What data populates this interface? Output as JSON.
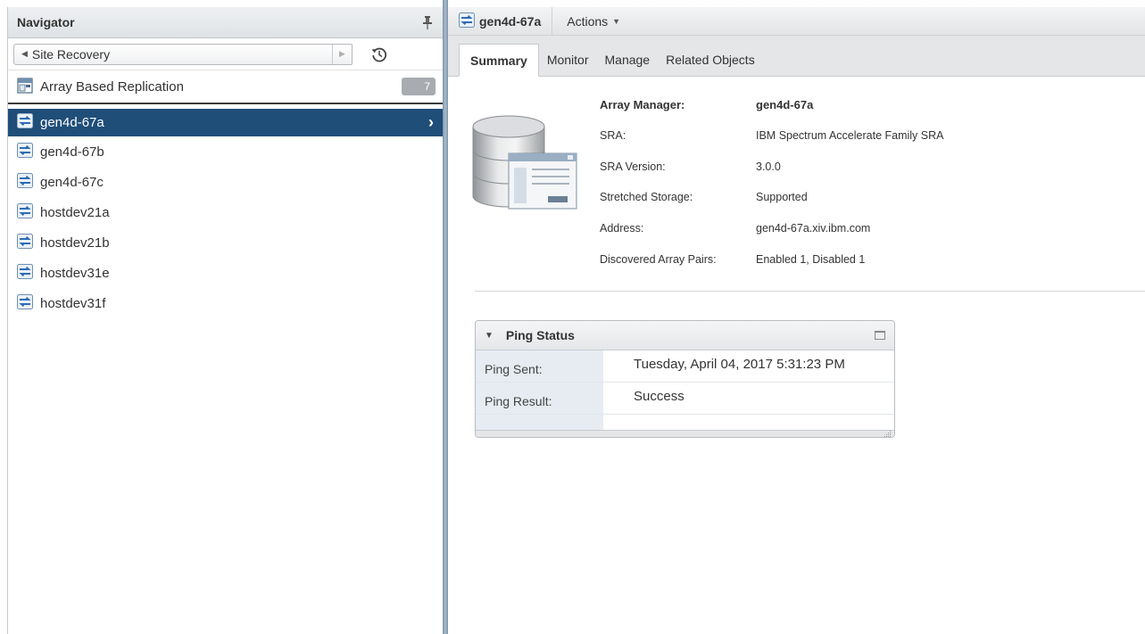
{
  "navigator": {
    "title": "Navigator",
    "back_label": "Site Recovery",
    "category": {
      "label": "Array Based Replication",
      "count": "7"
    },
    "items": [
      {
        "label": "gen4d-67a",
        "selected": true
      },
      {
        "label": "gen4d-67b"
      },
      {
        "label": "gen4d-67c"
      },
      {
        "label": "hostdev21a"
      },
      {
        "label": "hostdev21b"
      },
      {
        "label": "hostdev31e"
      },
      {
        "label": "hostdev31f"
      }
    ]
  },
  "header": {
    "object_title": "gen4d-67a",
    "actions_label": "Actions"
  },
  "tabs": [
    {
      "label": "Summary",
      "active": true
    },
    {
      "label": "Monitor"
    },
    {
      "label": "Manage"
    },
    {
      "label": "Related Objects"
    }
  ],
  "summary": {
    "properties": [
      {
        "key": "Array Manager:",
        "value": "gen4d-67a"
      },
      {
        "key": "SRA:",
        "value": "IBM Spectrum Accelerate Family SRA"
      },
      {
        "key": "SRA Version:",
        "value": "3.0.0"
      },
      {
        "key": "Stretched Storage:",
        "value": "Supported"
      },
      {
        "key": "Address:",
        "value": "gen4d-67a.xiv.ibm.com"
      },
      {
        "key": "Discovered Array Pairs:",
        "value": "Enabled 1, Disabled 1"
      }
    ]
  },
  "ping_status": {
    "title": "Ping Status",
    "rows": [
      {
        "key": "Ping Sent:",
        "value": "Tuesday, April 04, 2017 5:31:23 PM"
      },
      {
        "key": "Ping Result:",
        "value": "Success"
      }
    ]
  },
  "colors": {
    "selection": "#1f4e79",
    "splitter": "#8ea3b6",
    "key_cell": "#e6ecf2"
  },
  "icons": [
    "pin-icon",
    "history-icon",
    "array-replication-icon",
    "array-manager-icon",
    "database-icon",
    "maximize-icon"
  ]
}
